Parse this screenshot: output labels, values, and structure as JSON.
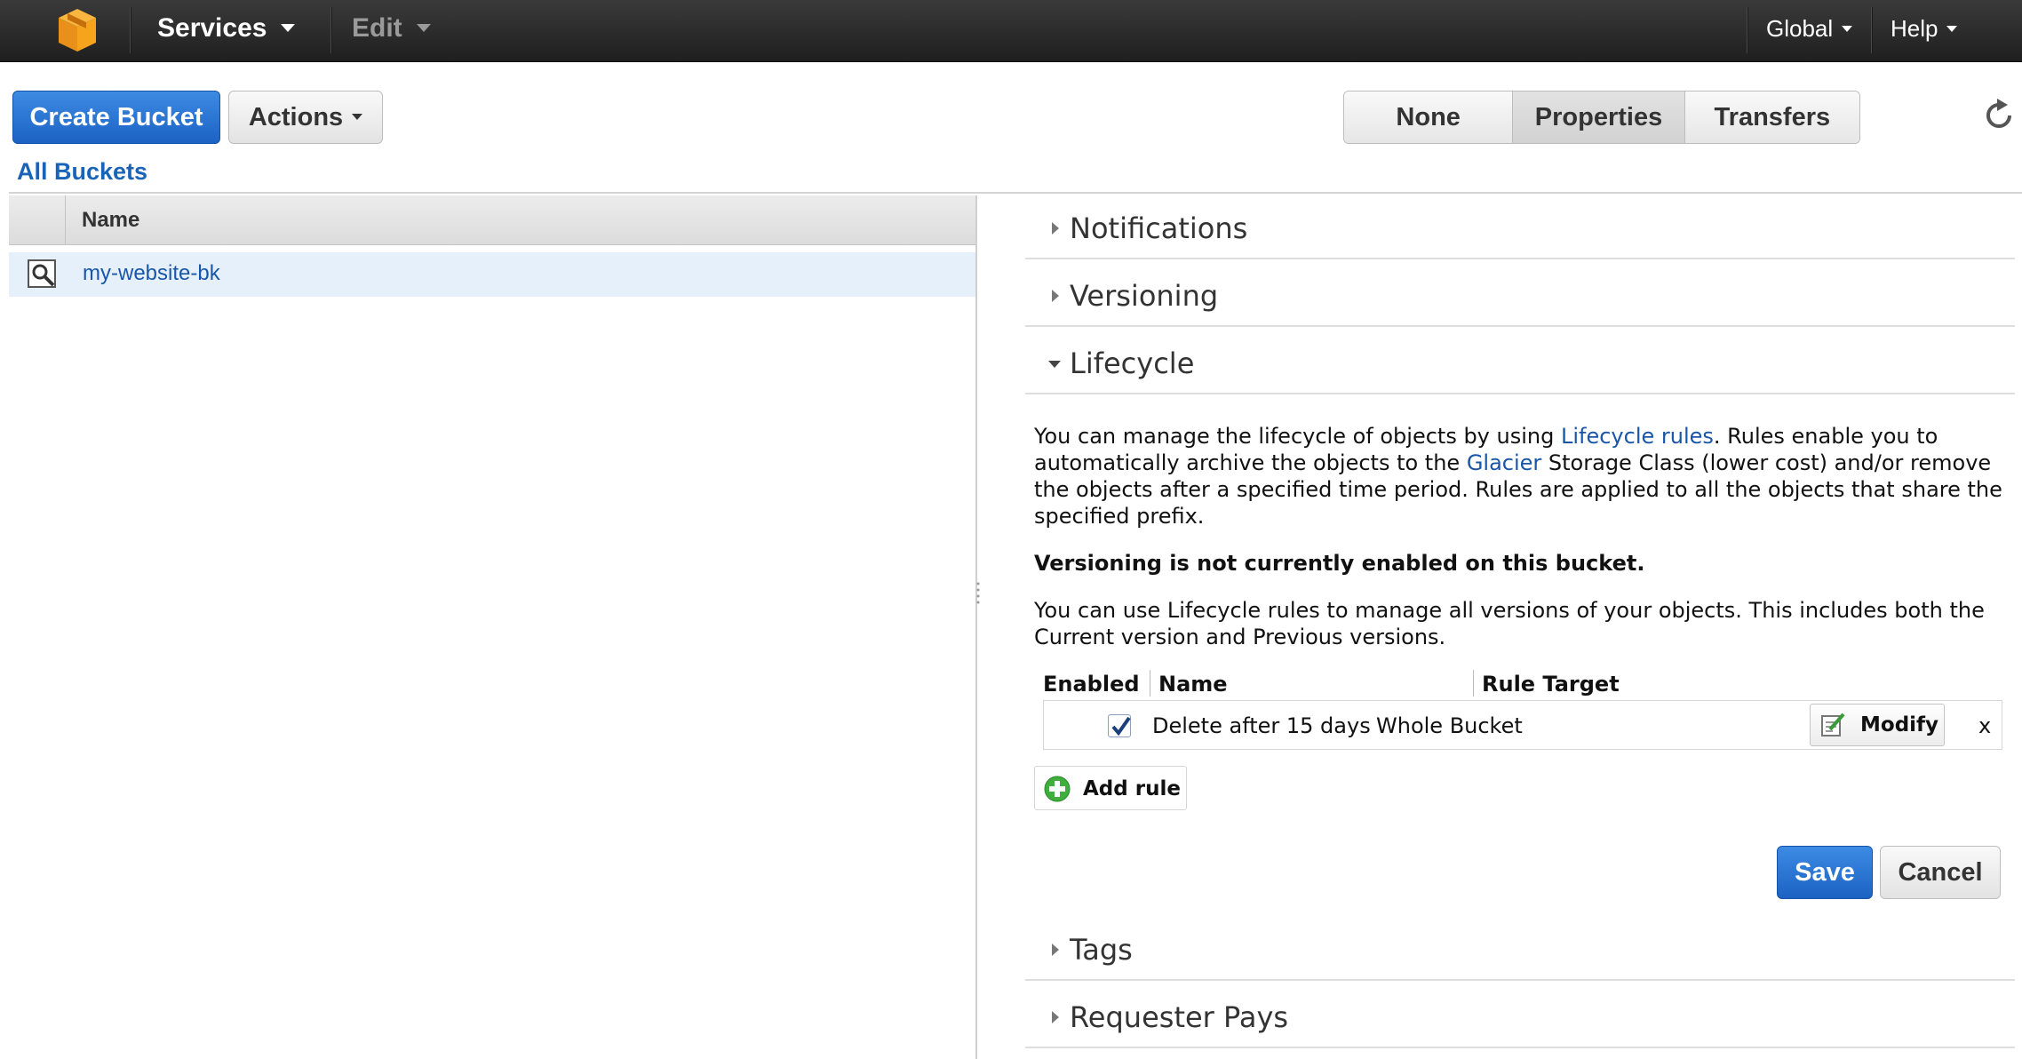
{
  "topnav": {
    "services_label": "Services",
    "edit_label": "Edit",
    "region_label": "Global",
    "help_label": "Help"
  },
  "toolbar": {
    "create_bucket_label": "Create Bucket",
    "actions_label": "Actions",
    "view_tabs": [
      {
        "label": "None",
        "active": false
      },
      {
        "label": "Properties",
        "active": true
      },
      {
        "label": "Transfers",
        "active": false
      }
    ]
  },
  "buckets": {
    "heading": "All Buckets",
    "column_name": "Name",
    "rows": [
      {
        "name": "my-website-bk"
      }
    ]
  },
  "properties": {
    "sections_top": [
      {
        "title": "Notifications",
        "expanded": false
      },
      {
        "title": "Versioning",
        "expanded": false
      },
      {
        "title": "Lifecycle",
        "expanded": true
      }
    ],
    "lifecycle": {
      "intro_1": "You can manage the lifecycle of objects by using ",
      "intro_link_1": "Lifecycle rules",
      "intro_2": ". Rules enable you to automatically archive the objects to the ",
      "intro_link_2": "Glacier",
      "intro_3": " Storage Class (lower cost) and/or remove the objects after a specified time period. Rules are applied to all the objects that share the specified prefix.",
      "versioning_note": "Versioning is not currently enabled on this bucket.",
      "versions_text": "You can use Lifecycle rules to manage all versions of your objects. This includes both the Current version and Previous versions.",
      "columns": {
        "enabled": "Enabled",
        "name": "Name",
        "target": "Rule Target"
      },
      "rules": [
        {
          "enabled": true,
          "name": "Delete after 15 days",
          "target": "Whole Bucket",
          "modify_label": "Modify",
          "delete_label": "x"
        }
      ],
      "add_rule_label": "Add rule",
      "save_label": "Save",
      "cancel_label": "Cancel"
    },
    "sections_bottom": [
      {
        "title": "Tags",
        "expanded": false
      },
      {
        "title": "Requester Pays",
        "expanded": false
      }
    ]
  },
  "colors": {
    "nav_bg": "#2b2b2b",
    "primary_button": "#1c62c4",
    "link": "#1a56a8",
    "selected_row": "#e6f0fb",
    "logo_orange": "#f7a41d"
  }
}
